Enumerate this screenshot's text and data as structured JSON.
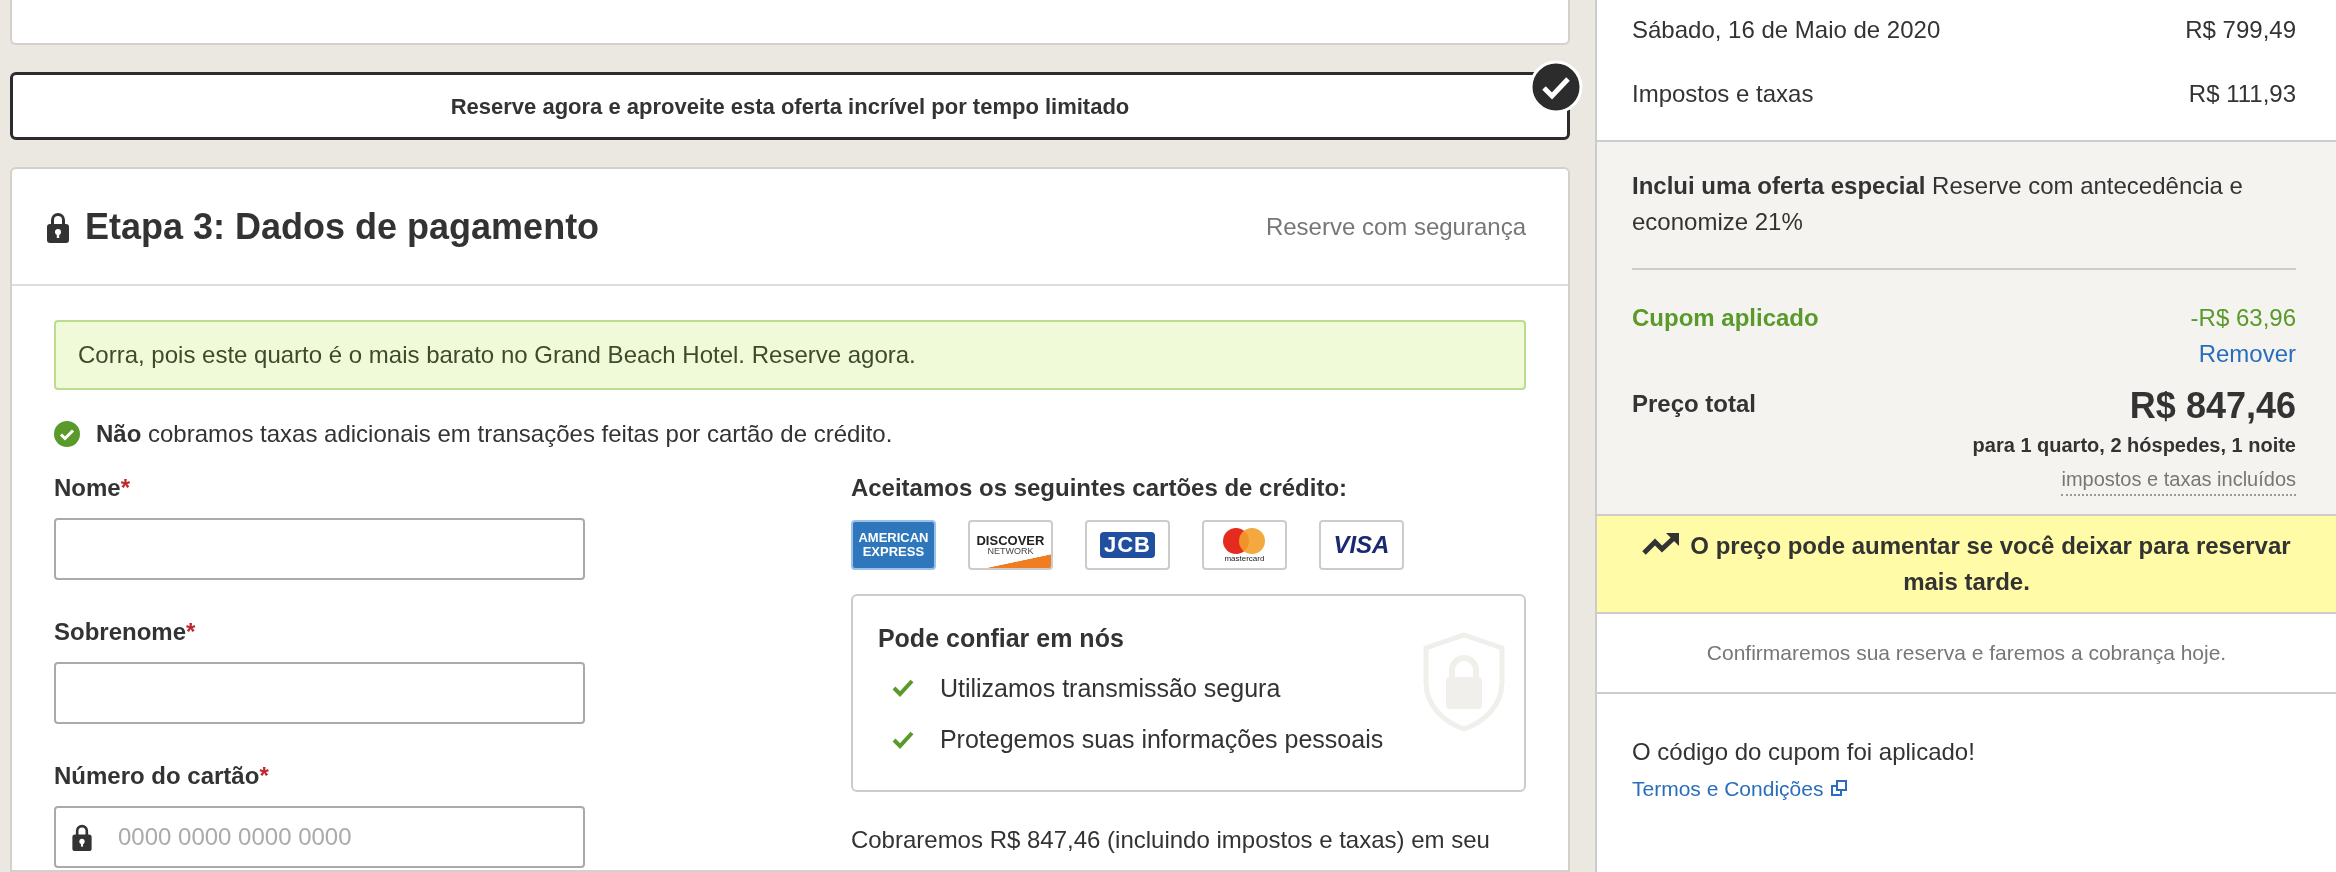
{
  "offer_banner": {
    "text": "Reserve agora e aproveite esta oferta incrível por tempo limitado",
    "checked": true
  },
  "payment": {
    "title": "Etapa 3: Dados de pagamento",
    "secure_label": "Reserve com segurança",
    "alert": "Corra, pois este quarto é o mais barato no Grand Beach Hotel. Reserve agora.",
    "notice": "**Não** cobramos taxas adicionais em transações feitas por cartão de crédito.",
    "fields": [
      {
        "kind": "text",
        "label": "Nome",
        "required_mark": "*"
      },
      {
        "kind": "text",
        "label": "Sobrenome",
        "required_mark": "*"
      },
      {
        "kind": "card_number",
        "label": "Número do cartão",
        "required_mark": "*",
        "placeholder": "0000 0000 0000 0000"
      }
    ],
    "cards_title": "Aceitamos os seguintes cartões de crédito:",
    "cards": [
      {
        "kind": "amex",
        "label": "AMERICAN EXPRESS"
      },
      {
        "kind": "discover",
        "label": "DISCOVER",
        "sub": "NETWORK"
      },
      {
        "kind": "jcb",
        "label": "JCB"
      },
      {
        "kind": "mastercard",
        "label": "mastercard"
      },
      {
        "kind": "visa",
        "label": "VISA"
      }
    ],
    "trust": {
      "title": "Pode confiar em nós",
      "items": [
        "Utilizamos transmissão segura",
        "Protegemos suas informações pessoais"
      ]
    },
    "charge_text": "Cobraremos R$ 847,46 (incluindo impostos e taxas) em seu"
  },
  "summary": {
    "lines": [
      {
        "label": "Sábado, 16 de Maio de 2020",
        "amount": "R$ 799,49"
      },
      {
        "label": "Impostos e taxas",
        "amount": "R$ 111,93"
      }
    ],
    "special_offer": "**Inclui uma oferta especial** Reserve com antecedência e economize 21%",
    "coupon": {
      "label": "Cupom aplicado",
      "amount": "-R$ 63,96",
      "remove": "Remover"
    },
    "total": {
      "label": "Preço total",
      "amount": "R$ 847,46",
      "detail": "para 1 quarto, 2 hóspedes, 1 noite",
      "taxes_note": "impostos e taxas incluídos"
    },
    "urgency": "O preço pode aumentar se você deixar para reservar mais tarde.",
    "confirm": "Confirmaremos sua reserva e faremos a cobrança hoje.",
    "coupon_message": "O código do cupom foi aplicado!",
    "terms_link": "Termos e Condições"
  }
}
